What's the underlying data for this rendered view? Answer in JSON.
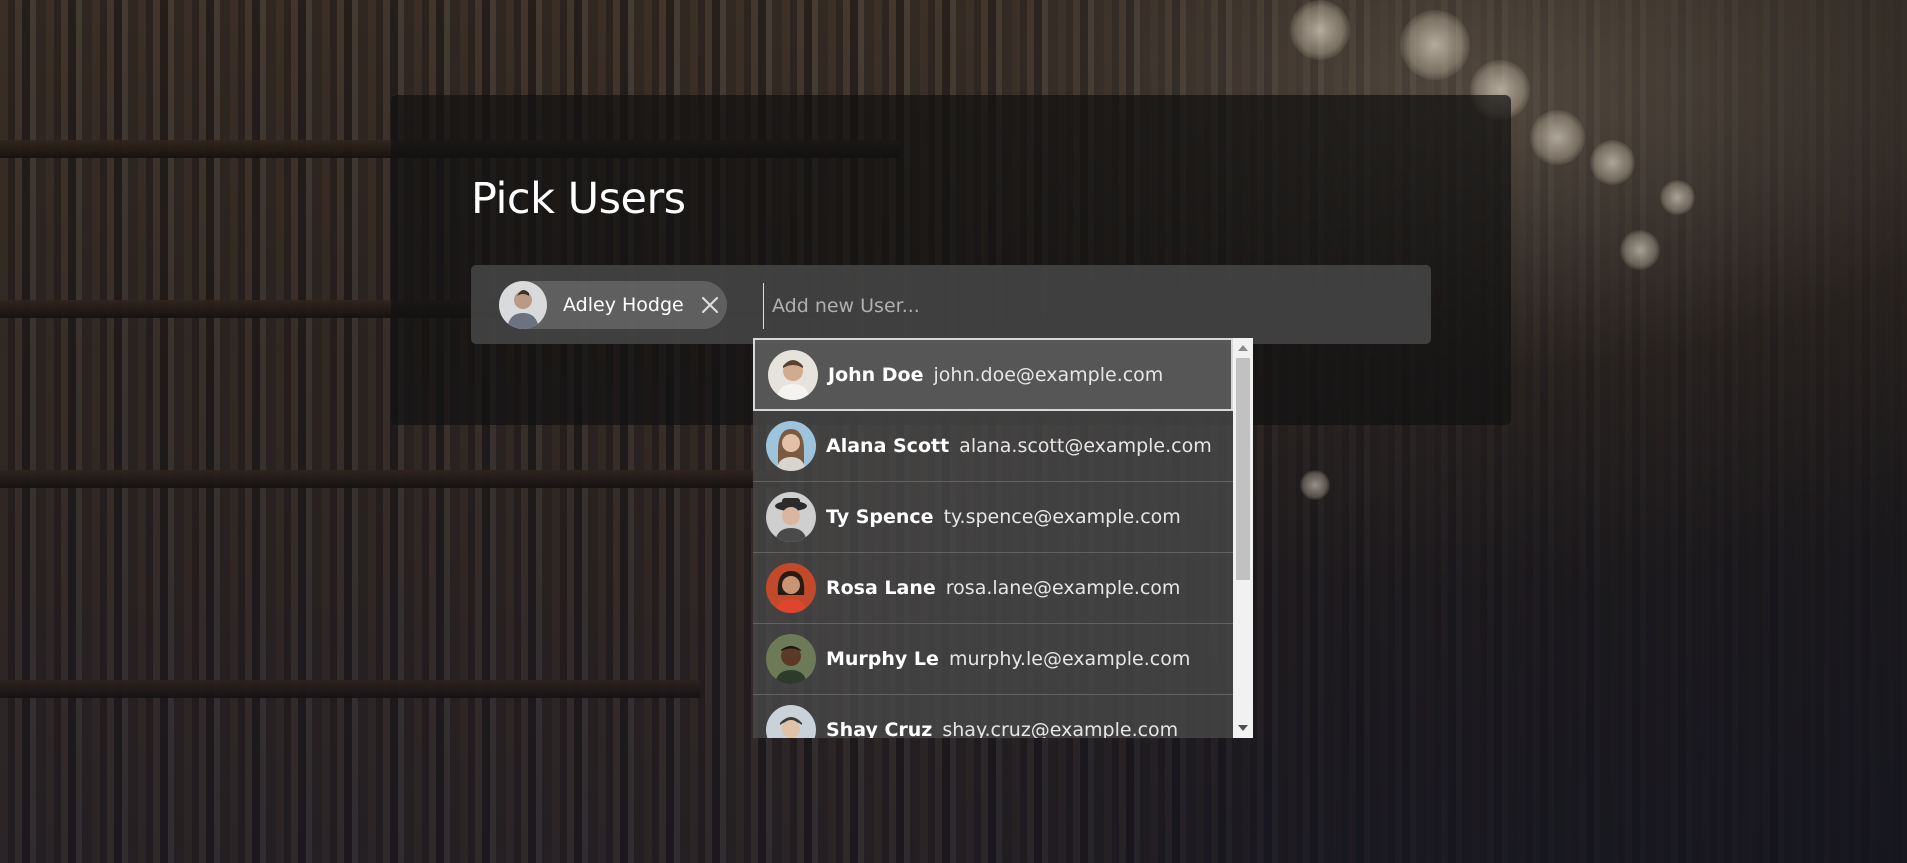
{
  "page": {
    "title": "Pick Users"
  },
  "picker": {
    "placeholder": "Add new User...",
    "selected": [
      {
        "name": "Adley Hodge",
        "avatar_color": "#8a8f96"
      }
    ]
  },
  "dropdown": {
    "items": [
      {
        "name": "John Doe",
        "email": "john.doe@example.com",
        "avatar_color": "#c9b8a6",
        "active": true
      },
      {
        "name": "Alana Scott",
        "email": "alana.scott@example.com",
        "avatar_color": "#a6c4d8"
      },
      {
        "name": "Ty Spence",
        "email": "ty.spence@example.com",
        "avatar_color": "#9a9a9a"
      },
      {
        "name": "Rosa Lane",
        "email": "rosa.lane@example.com",
        "avatar_color": "#c25a3a"
      },
      {
        "name": "Murphy Le",
        "email": "murphy.le@example.com",
        "avatar_color": "#6b7a5a"
      },
      {
        "name": "Shay Cruz",
        "email": "shay.cruz@example.com",
        "avatar_color": "#b8c4cc"
      }
    ]
  },
  "icons": {
    "chip_remove": "close-icon",
    "scroll_up": "scroll-up-arrow-icon",
    "scroll_down": "scroll-down-arrow-icon"
  }
}
